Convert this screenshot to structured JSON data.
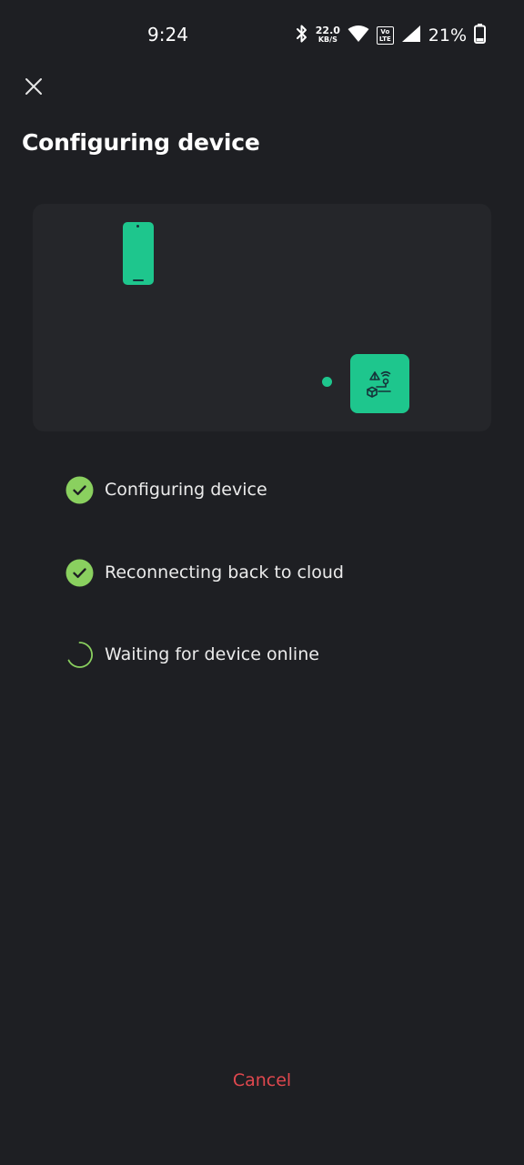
{
  "status_bar": {
    "time": "9:24",
    "net_speed_value": "22.0",
    "net_speed_unit": "KB/S",
    "volte_top": "Vo",
    "volte_bottom": "LTE",
    "battery_percent": "21%",
    "icons": [
      "bluetooth-icon",
      "wifi-icon",
      "signal-icon",
      "battery-icon"
    ]
  },
  "header": {
    "close_icon": "close-icon",
    "title": "Configuring device"
  },
  "illustration": {
    "accent_color": "#1ec68d",
    "icons": [
      "phone-icon",
      "device-icon"
    ]
  },
  "steps": [
    {
      "label": "Configuring device",
      "status": "done"
    },
    {
      "label": "Reconnecting back to cloud",
      "status": "done"
    },
    {
      "label": "Waiting for device online",
      "status": "in-progress"
    }
  ],
  "colors": {
    "background": "#1e1f23",
    "card": "#25262a",
    "check": "#8ad05f",
    "cancel": "#e0484e"
  },
  "footer": {
    "cancel_label": "Cancel"
  }
}
